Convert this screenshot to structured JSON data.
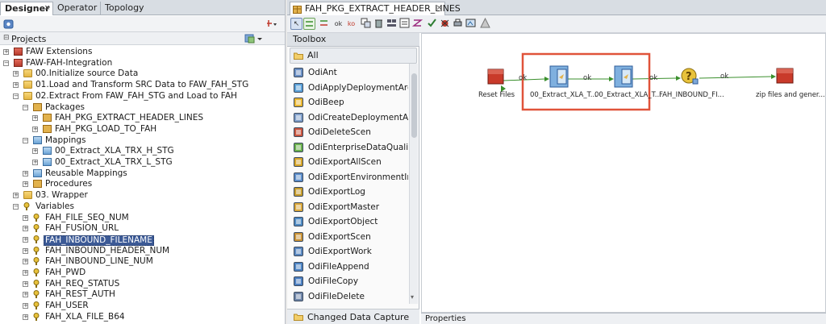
{
  "left_tabs": [
    "Designer",
    "Operator",
    "Topology"
  ],
  "projects_header": "Projects",
  "tree": [
    {
      "label": "FAW Extensions",
      "exp": "+",
      "kind": "proj",
      "indent": 0
    },
    {
      "label": "FAW-FAH-Integration",
      "exp": "-",
      "kind": "proj",
      "indent": 0
    },
    {
      "label": "00.Initialize source Data",
      "exp": "+",
      "kind": "folder",
      "indent": 1
    },
    {
      "label": "01.Load and Transform SRC Data to FAW_FAH_STG",
      "exp": "+",
      "kind": "folder",
      "indent": 1
    },
    {
      "label": "02.Extract From FAW_FAH_STG and Load to FAH",
      "exp": "-",
      "kind": "folder",
      "indent": 1
    },
    {
      "label": "Packages",
      "exp": "-",
      "kind": "pkg",
      "indent": 2
    },
    {
      "label": "FAH_PKG_EXTRACT_HEADER_LINES",
      "exp": "+",
      "kind": "pkg",
      "indent": 3
    },
    {
      "label": "FAH_PKG_LOAD_TO_FAH",
      "exp": "+",
      "kind": "pkg",
      "indent": 3
    },
    {
      "label": "Mappings",
      "exp": "-",
      "kind": "map",
      "indent": 2
    },
    {
      "label": "00_Extract_XLA_TRX_H_STG",
      "exp": "+",
      "kind": "map",
      "indent": 3
    },
    {
      "label": "00_Extract_XLA_TRX_L_STG",
      "exp": "+",
      "kind": "map",
      "indent": 3
    },
    {
      "label": "Reusable Mappings",
      "exp": "+",
      "kind": "map",
      "indent": 2
    },
    {
      "label": "Procedures",
      "exp": "+",
      "kind": "pkg",
      "indent": 2
    },
    {
      "label": "03. Wrapper",
      "exp": "+",
      "kind": "folder",
      "indent": 1
    },
    {
      "label": "Variables",
      "exp": "-",
      "kind": "var",
      "indent": 1
    },
    {
      "label": "FAH_FILE_SEQ_NUM",
      "exp": "+",
      "kind": "var",
      "indent": 2
    },
    {
      "label": "FAH_FUSION_URL",
      "exp": "+",
      "kind": "var",
      "indent": 2
    },
    {
      "label": "FAH_INBOUND_FILENAME",
      "exp": "+",
      "kind": "var",
      "indent": 2,
      "selected": true
    },
    {
      "label": "FAH_INBOUND_HEADER_NUM",
      "exp": "+",
      "kind": "var",
      "indent": 2
    },
    {
      "label": "FAH_INBOUND_LINE_NUM",
      "exp": "+",
      "kind": "var",
      "indent": 2
    },
    {
      "label": "FAH_PWD",
      "exp": "+",
      "kind": "var",
      "indent": 2
    },
    {
      "label": "FAH_REQ_STATUS",
      "exp": "+",
      "kind": "var",
      "indent": 2
    },
    {
      "label": "FAH_REST_AUTH",
      "exp": "+",
      "kind": "var",
      "indent": 2
    },
    {
      "label": "FAH_USER",
      "exp": "+",
      "kind": "var",
      "indent": 2
    },
    {
      "label": "FAH_XLA_FILE_B64",
      "exp": "+",
      "kind": "var",
      "indent": 2
    }
  ],
  "editor_tab": "FAH_PKG_EXTRACT_HEADER_LINES",
  "toolbox": {
    "title": "Toolbox",
    "all_label": "All",
    "items": [
      "OdiAnt",
      "OdiApplyDeploymentArchive",
      "OdiBeep",
      "OdiCreateDeploymentArchive",
      "OdiDeleteScen",
      "OdiEnterpriseDataQuality",
      "OdiExportAllScen",
      "OdiExportEnvironmentInformation",
      "OdiExportLog",
      "OdiExportMaster",
      "OdiExportObject",
      "OdiExportScen",
      "OdiExportWork",
      "OdiFileAppend",
      "OdiFileCopy",
      "OdiFileDelete"
    ],
    "footer": "Changed Data Capture"
  },
  "diagram": {
    "nodes": [
      {
        "label": "Reset Files",
        "kind": "red"
      },
      {
        "label": "00_Extract_XLA_T...",
        "kind": "map"
      },
      {
        "label": "00_Extract_XLA_T...",
        "kind": "map"
      },
      {
        "label": "FAH_INBOUND_FI...",
        "kind": "var"
      },
      {
        "label": "zip files and gener...",
        "kind": "red"
      }
    ],
    "edge_labels": [
      "ok",
      "ok",
      "ok",
      "ok"
    ],
    "highlight_color": "#e0533a"
  },
  "properties_label": "Properties"
}
